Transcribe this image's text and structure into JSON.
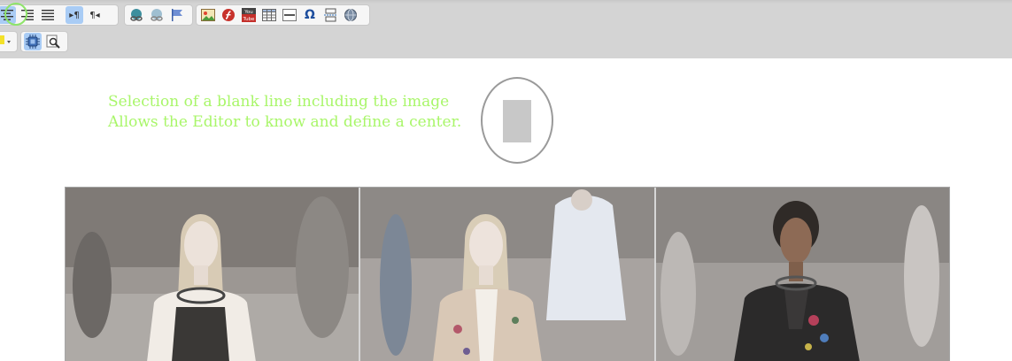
{
  "toolbar": {
    "row1_left": [
      {
        "name": "align-center",
        "active": true
      },
      {
        "name": "align-right",
        "active": false
      },
      {
        "name": "align-justify",
        "active": false
      },
      {
        "name": "ltr-direction",
        "active": true,
        "glyph": "▸¶"
      },
      {
        "name": "rtl-direction",
        "active": false,
        "glyph": "¶◂"
      }
    ],
    "link_group": [
      "link",
      "unlink",
      "anchor"
    ],
    "insert_group": [
      "image",
      "flash",
      "youtube",
      "table",
      "horizontal-rule",
      "special-char",
      "page-break",
      "iframe"
    ],
    "youtube_label_top": "You",
    "youtube_label_bottom": "Tube",
    "special_char_glyph": "Ω"
  },
  "note": {
    "line1": "Selection of a blank line including the image",
    "line2": "Allows the Editor to know and define a center."
  },
  "colors": {
    "note_text": "#a9f66a",
    "highlight_ring": "#8ee46a",
    "active_button": "#a9ccf5"
  },
  "gallery": {
    "panels": 3
  }
}
